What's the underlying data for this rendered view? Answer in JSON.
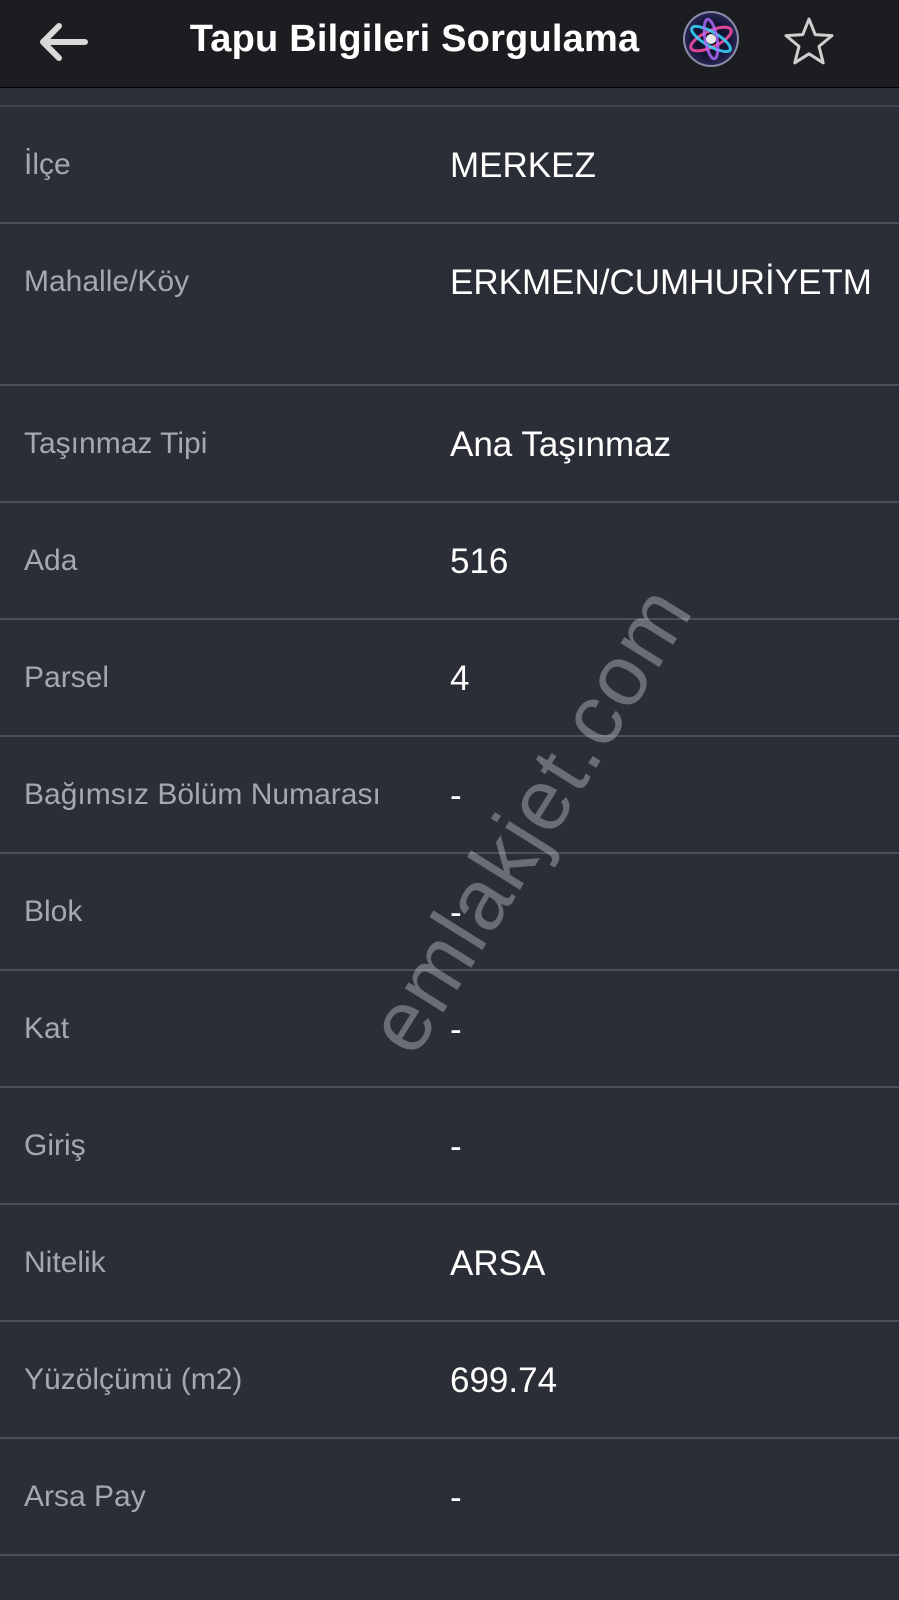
{
  "header": {
    "title": "Tapu Bilgileri Sorgulama",
    "back_icon": "arrow-left-icon",
    "siri_icon": "siri-icon",
    "favorite_icon": "star-outline-icon"
  },
  "rows": [
    {
      "label": "İlçe",
      "value": "MERKEZ"
    },
    {
      "label": "Mahalle/Köy",
      "value": "ERKMEN/CUMHURİYETM"
    },
    {
      "label": "Taşınmaz Tipi",
      "value": "Ana Taşınmaz"
    },
    {
      "label": "Ada",
      "value": "516"
    },
    {
      "label": "Parsel",
      "value": "4"
    },
    {
      "label": "Bağımsız Bölüm Numarası",
      "value": "-"
    },
    {
      "label": "Blok",
      "value": "-"
    },
    {
      "label": "Kat",
      "value": "-"
    },
    {
      "label": "Giriş",
      "value": "-"
    },
    {
      "label": "Nitelik",
      "value": "ARSA"
    },
    {
      "label": "Yüzölçümü (m2)",
      "value": "699.74"
    },
    {
      "label": "Arsa Pay",
      "value": "-"
    }
  ],
  "watermark": "emlakjet.com",
  "colors": {
    "header_bg": "#1c1d20",
    "body_bg": "#2b2e37",
    "divider": "#4b4f5a",
    "label_text": "#a6a8ae",
    "value_text": "#ffffff"
  }
}
